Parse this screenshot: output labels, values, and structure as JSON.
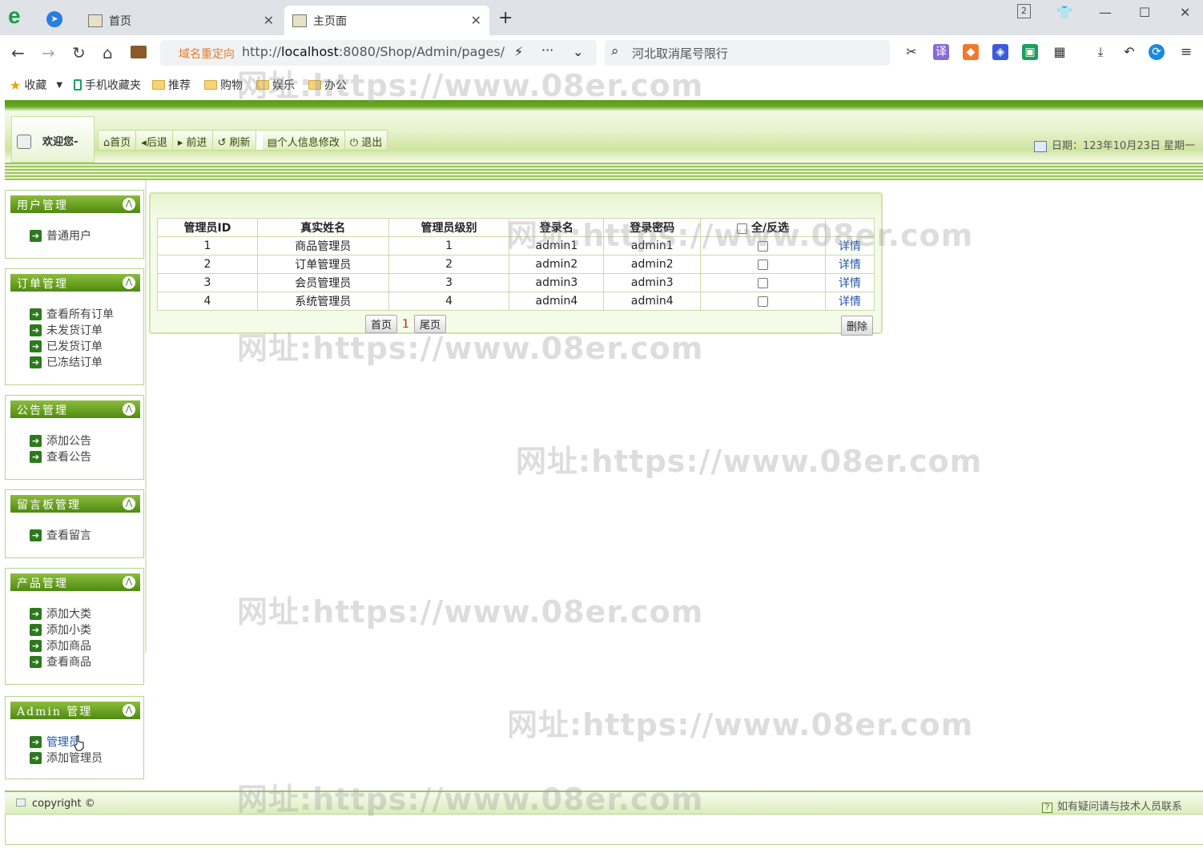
{
  "browser": {
    "tabs": [
      {
        "title": "首页"
      },
      {
        "title": "主页面"
      }
    ],
    "redirect_label": "域名重定向",
    "url_prefix": "http://",
    "url_host": "localhost",
    "url_rest": ":8080/Shop/Admin/pages/",
    "search_placeholder": "河北取消尾号限行",
    "tab_count_badge": "2",
    "bookmarks": [
      "收藏",
      "手机收藏夹",
      "推荐",
      "购物",
      "娱乐",
      "办公"
    ]
  },
  "header": {
    "welcome": "欢迎您-",
    "toolbar": [
      "首页",
      "后退",
      "前进",
      "刷新",
      "个人信息修改",
      "退出"
    ],
    "date": "日期：123年10月23日 星期一"
  },
  "sidebar": [
    {
      "title": "用户管理",
      "items": [
        "普通用户"
      ]
    },
    {
      "title": "订单管理",
      "items": [
        "查看所有订单",
        "未发货订单",
        "已发货订单",
        "已冻结订单"
      ]
    },
    {
      "title": "公告管理",
      "items": [
        "添加公告",
        "查看公告"
      ]
    },
    {
      "title": "留言板管理",
      "items": [
        "查看留言"
      ]
    },
    {
      "title": "产品管理",
      "items": [
        "添加大类",
        "添加小类",
        "添加商品",
        "查看商品"
      ]
    },
    {
      "title": "Admin 管理",
      "items": [
        "管理员",
        "添加管理员"
      ]
    }
  ],
  "table": {
    "headers": [
      "管理员ID",
      "真实姓名",
      "管理员级别",
      "登录名",
      "登录密码",
      "全/反选",
      ""
    ],
    "rows": [
      {
        "id": "1",
        "name": "商品管理员",
        "level": "1",
        "login": "admin1",
        "password": "admin1",
        "action": "详情"
      },
      {
        "id": "2",
        "name": "订单管理员",
        "level": "2",
        "login": "admin2",
        "password": "admin2",
        "action": "详情"
      },
      {
        "id": "3",
        "name": "会员管理员",
        "level": "3",
        "login": "admin3",
        "password": "admin3",
        "action": "详情"
      },
      {
        "id": "4",
        "name": "系统管理员",
        "level": "4",
        "login": "admin4",
        "password": "admin4",
        "action": "详情"
      }
    ]
  },
  "pager": {
    "first": "首页",
    "current": "1",
    "last": "尾页"
  },
  "delete_label": "删除",
  "footer": {
    "copyright": "copyright ©",
    "contact": "如有疑问请与技术人员联系"
  },
  "watermark": "网址:https://www.08er.com",
  "colors": {
    "accent_green": "#4f8a12",
    "link_blue": "#2255aa",
    "page_number_red": "#c02020"
  }
}
